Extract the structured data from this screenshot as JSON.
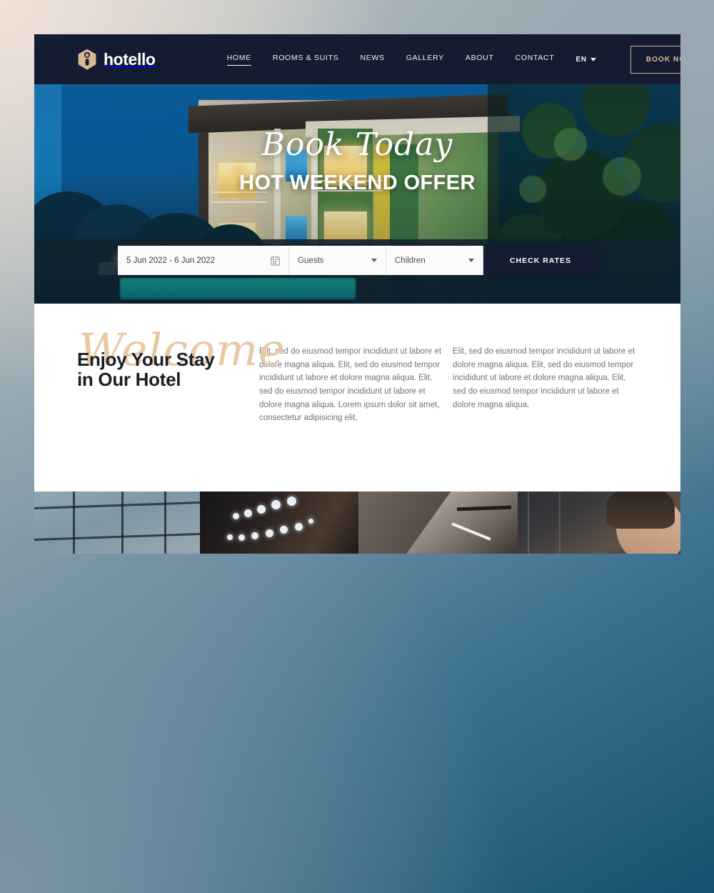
{
  "theme": {
    "header_bg": "#131c30",
    "accent_tan": "#e3bd97",
    "script_tan": "#e8c9a4",
    "text_dark": "#1d1d23",
    "body_text": "#6e7280",
    "white": "#ffffff"
  },
  "header": {
    "brand": {
      "name": "hotello",
      "mark_icon": "hexagon-star-logo-icon"
    },
    "nav": [
      {
        "label": "HOME",
        "active": true
      },
      {
        "label": "ROOMS & SUITS",
        "active": false
      },
      {
        "label": "NEWS",
        "active": false
      },
      {
        "label": "GALLERY",
        "active": false
      },
      {
        "label": "ABOUT",
        "active": false
      },
      {
        "label": "CONTACT",
        "active": false
      }
    ],
    "language": {
      "value": "EN",
      "caret_icon": "chevron-down-icon"
    },
    "cta": {
      "label": "BOOK NOW"
    }
  },
  "hero": {
    "script_line": "Book Today",
    "title": "HOT WEEKEND OFFER",
    "booking": {
      "date_value": "5 Jun 2022 - 6 Jun 2022",
      "date_icon": "calendar-icon",
      "guests_value": "Guests",
      "children_value": "Children",
      "select_caret_icon": "chevron-down-icon",
      "submit_label": "CHECK RATES"
    }
  },
  "welcome": {
    "script": "Welcome",
    "heading_line1": "Enjoy Your Stay",
    "heading_line2": "in Our Hotel",
    "column1": "Elit, sed do eiusmod tempor incididunt ut labore et dolore magna aliqua. Elit, sed do eiusmod tempor incididunt ut labore et dolore magna aliqua. Elit, sed do eiusmod tempor incididunt ut labore et dolore magna aliqua. Lorem ipsum dolor sit amet, consectetur adipisicing elit,",
    "column2": "Elit, sed do eiusmod tempor incididunt ut labore et dolore magna aliqua. Elit, sed do eiusmod tempor incididunt ut labore et dolore magna aliqua. Elit, sed do eiusmod tempor incididunt ut labore et dolore magna aliqua."
  },
  "gallery": {
    "items": [
      {
        "name": "glass-facade-photo"
      },
      {
        "name": "lounge-lights-photo"
      },
      {
        "name": "modern-staircase-photo"
      },
      {
        "name": "woman-portrait-photo"
      }
    ]
  }
}
